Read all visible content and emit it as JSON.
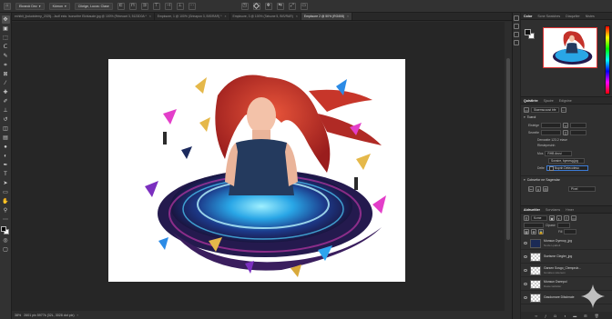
{
  "options_bar": {
    "items": [
      "Ekrandı Dez",
      "Kümon",
      "Cikrige, Lucos: Clase"
    ]
  },
  "tabs": [
    {
      "label": "exhibit_ljsduotdemp_2025j...Jsofl ests: Isonoritre Ekirkaude.jpg @ 100% (Rrbeuart 3, 5123D0A *",
      "active": false
    },
    {
      "label": "Empksore, 1 @ 100% (Grinapon 3, BIS/RAR) *",
      "active": false
    },
    {
      "label": "Empksore, 3 @ 100% (Tatsone 5, BIS/RAR)",
      "active": false
    },
    {
      "label": "Empksore 2 @ 50% (RG/8/8)",
      "active": true
    }
  ],
  "tools": [
    "move",
    "artboard",
    "marquee",
    "lasso",
    "quick-select",
    "crop",
    "frame",
    "eyedropper",
    "healing",
    "brush",
    "clone-stamp",
    "history-brush",
    "eraser",
    "gradient",
    "blur",
    "dodge",
    "pen",
    "type",
    "path-select",
    "rectangle",
    "hand",
    "zoom",
    "more"
  ],
  "status": {
    "zoom": "38%",
    "info": "2601 pix 5977k (32L, 3028 dot pix)"
  },
  "panels": {
    "top_tabs": [
      "Color",
      "Scne Swatches",
      "Diaqurlter",
      "Nistes"
    ],
    "properties_tabs": [
      "Quistlrée",
      "Sjauire",
      "Edigstne"
    ],
    "layers_tabs": [
      "Aidrueitler",
      "Sorvdams",
      "Hmer"
    ]
  },
  "properties": {
    "doc_label": "Staemscoost bfe",
    "field_w_label": "Elstelge",
    "field_h_label": "Sewelte",
    "section1": "Tozrol",
    "line1": "Denwatte 123.2 etase",
    "line2": "Rleslepesinh",
    "mode_label": "Mos",
    "mode_value": "RHB Arusi",
    "select_value": "Sonsire, bymesg.jpg",
    "bits_label": "Delte",
    "bits_value": "Nspnh Detecoteso",
    "section2": "Cobsefor ne Sagendar",
    "ppi_value": "PIxel"
  },
  "layers": {
    "search_label": "Kcme",
    "opacity_label": "Clpastr",
    "fill_label": "Fill",
    "items": [
      {
        "name": "Monsun Dyenop_jpg",
        "sub": "Nocle Lpabelt",
        "selected": false,
        "thumb": "image"
      },
      {
        "name": "Ssetsme Clegler_jpg",
        "sub": "",
        "selected": false,
        "thumb": "checker"
      },
      {
        "name": "Garsen Sosgo_Clemprub...",
        "sub": "Gmatteo sstereon",
        "selected": false,
        "thumb": "checker"
      },
      {
        "name": "Monsun Dseepol",
        "sub": "Daste lasfatter",
        "selected": false,
        "thumb": "checker"
      },
      {
        "name": "Gasdumare Dilsdmaie",
        "sub": "",
        "selected": false,
        "thumb": "checker"
      }
    ]
  },
  "colors": {
    "accent": "#3b7bd6",
    "panel": "#2f2f2f",
    "canvas_bg": "#262626"
  }
}
